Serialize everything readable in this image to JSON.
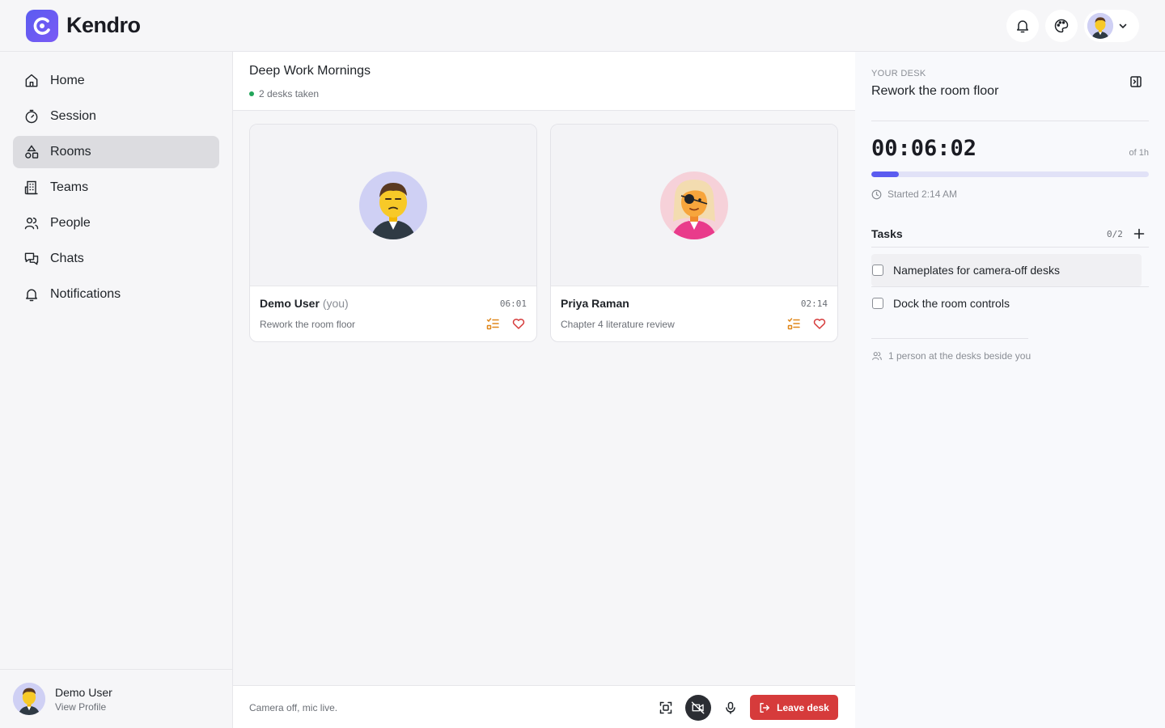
{
  "app": {
    "brand": "Kendro"
  },
  "topbar": {
    "icons": [
      "bell-icon",
      "palette-icon",
      "chevron-down-icon"
    ]
  },
  "sidebar": {
    "items": [
      {
        "label": "Home",
        "icon": "home-icon",
        "active": false
      },
      {
        "label": "Session",
        "icon": "timer-icon",
        "active": false
      },
      {
        "label": "Rooms",
        "icon": "rooms-icon",
        "active": true
      },
      {
        "label": "Teams",
        "icon": "building-icon",
        "active": false
      },
      {
        "label": "People",
        "icon": "users-icon",
        "active": false
      },
      {
        "label": "Chats",
        "icon": "chat-icon",
        "active": false
      },
      {
        "label": "Notifications",
        "icon": "bell-icon",
        "active": false
      }
    ],
    "profile": {
      "name": "Demo User",
      "link": "View Profile"
    }
  },
  "room": {
    "title": "Deep Work Mornings",
    "status": "2 desks taken",
    "desks": [
      {
        "name": "Demo User",
        "you": "(you)",
        "time": "06:01",
        "task": "Rework the room floor"
      },
      {
        "name": "Priya Raman",
        "you": "",
        "time": "02:14",
        "task": "Chapter 4 literature review"
      }
    ],
    "bottom": {
      "status": "Camera off, mic live.",
      "leave": "Leave desk"
    }
  },
  "desk_panel": {
    "kicker": "YOUR DESK",
    "title": "Rework the room floor",
    "timer": "00:06:02",
    "of": "of 1h",
    "progress_fraction": 0.1,
    "started": "Started 2:14 AM",
    "tasks_label": "Tasks",
    "tasks_count": "0/2",
    "tasks": [
      {
        "label": "Nameplates for camera-off desks",
        "done": false
      },
      {
        "label": "Dock the room controls",
        "done": false
      }
    ],
    "beside": "1 person at the desks beside you"
  },
  "colors": {
    "accent": "#5b5cf0",
    "danger": "#d63b3b",
    "online": "#22a55a"
  }
}
